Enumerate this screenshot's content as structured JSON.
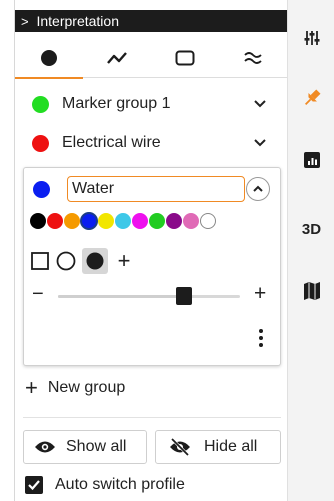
{
  "panel": {
    "title": "Interpretation",
    "tabs": [
      {
        "icon": "point-marker-icon",
        "active": true
      },
      {
        "icon": "polyline-icon",
        "active": false
      },
      {
        "icon": "rectangle-icon",
        "active": false
      },
      {
        "icon": "surface-icon",
        "active": false
      }
    ]
  },
  "groups": [
    {
      "label": "Marker group 1",
      "color": "#22dd22"
    },
    {
      "label": "Electrical wire",
      "color": "#ee1111"
    }
  ],
  "editor": {
    "name_value": "Water",
    "color": "#0a1ef0",
    "swatches": [
      "#000000",
      "#ee1111",
      "#f59a00",
      "#0a1ef0",
      "#f2e600",
      "#3ec8e8",
      "#ee11ee",
      "#22cc22",
      "#8a0a8a",
      "#e06ab6",
      "#ffffff"
    ],
    "selected_swatch_index": 3,
    "shape_plus": "+",
    "slider_minus": "−",
    "slider_plus": "+",
    "slider_value": 0.69
  },
  "actions": {
    "new_group_plus": "+",
    "new_group_label": "New group",
    "show_all_label": "Show all",
    "hide_all_label": "Hide all",
    "auto_switch_label": "Auto switch profile",
    "auto_switch_checked": true
  },
  "sidebar": {
    "items": [
      {
        "icon": "sliders-icon"
      },
      {
        "icon": "pin-icon",
        "active_color": "#f08a24"
      },
      {
        "icon": "chart-icon"
      },
      {
        "label": "3D"
      },
      {
        "icon": "map-icon"
      }
    ]
  },
  "colors": {
    "accent": "#f08a24",
    "dark": "#1c1c1c"
  }
}
